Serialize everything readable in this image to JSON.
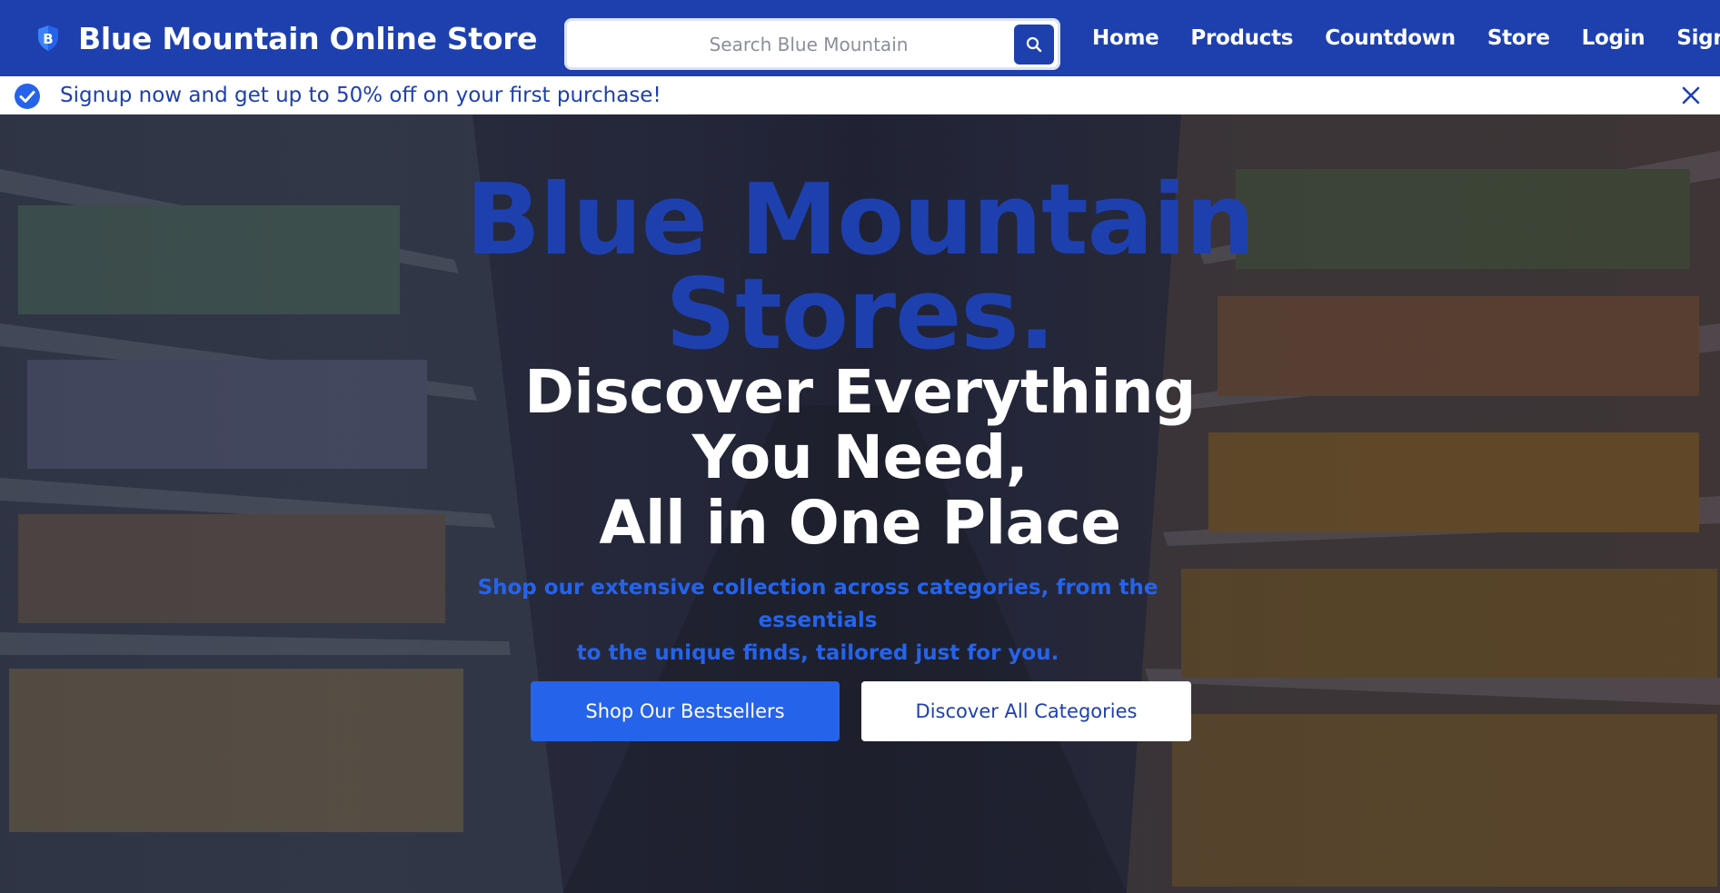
{
  "navbar": {
    "brand_name": "Blue Mountain Online Store",
    "brand_icon": "shield-b-icon",
    "brand_letter": "B",
    "search_placeholder": "Search Blue Mountain",
    "search_icon": "search-icon",
    "links": [
      "Home",
      "Products",
      "Countdown",
      "Store",
      "Login",
      "Signup"
    ]
  },
  "promo": {
    "text": "Signup now and get up to 50% off on your first purchase!",
    "check_icon": "check-circle-icon",
    "close_icon": "close-icon"
  },
  "hero": {
    "title_line1": "Blue Mountain",
    "title_line2": "Stores.",
    "subtitle_line1": "Discover Everything",
    "subtitle_line2": "You Need,",
    "subtitle_line3": "All in One Place",
    "description_line1": "Shop our extensive collection across categories, from the essentials",
    "description_line2": "to the unique finds, tailored just for you.",
    "primary_button": "Shop Our Bestsellers",
    "secondary_button": "Discover All Categories",
    "background": "supermarket-aisle-photo"
  },
  "colors": {
    "brand_blue": "#1e40af",
    "accent_blue": "#2563eb",
    "white": "#ffffff"
  }
}
